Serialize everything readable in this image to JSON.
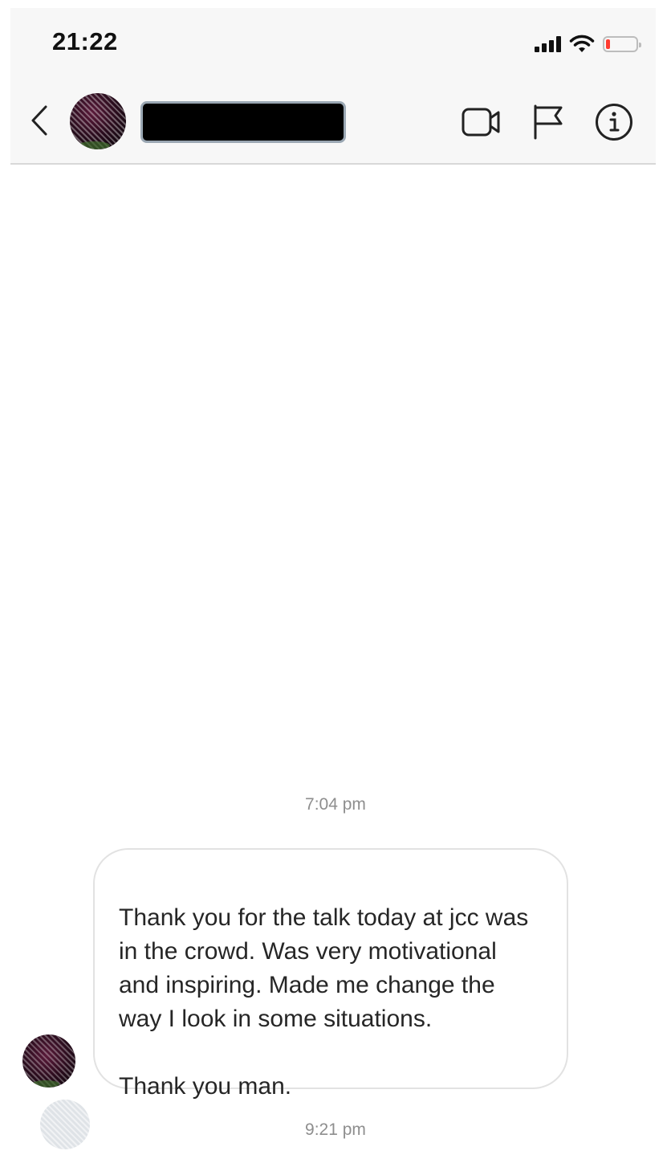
{
  "status_bar": {
    "time": "21:22",
    "battery_level": 0.15,
    "battery_color": "#ff3b30"
  },
  "header": {
    "back_icon": "chevron-left-icon",
    "avatar": "contact-avatar",
    "name_redacted": true,
    "actions": [
      {
        "icon": "video-camera-icon"
      },
      {
        "icon": "flag-icon"
      },
      {
        "icon": "info-icon"
      }
    ]
  },
  "conversation": {
    "timestamp_first": "7:04 pm",
    "message": {
      "text": "Thank you for the talk today at jcc was in the crowd. Was very motivational and inspiring. Made me change the way I look in some situations.",
      "text_line2": "Thank you man."
    },
    "timestamp_second": "9:21 pm"
  }
}
